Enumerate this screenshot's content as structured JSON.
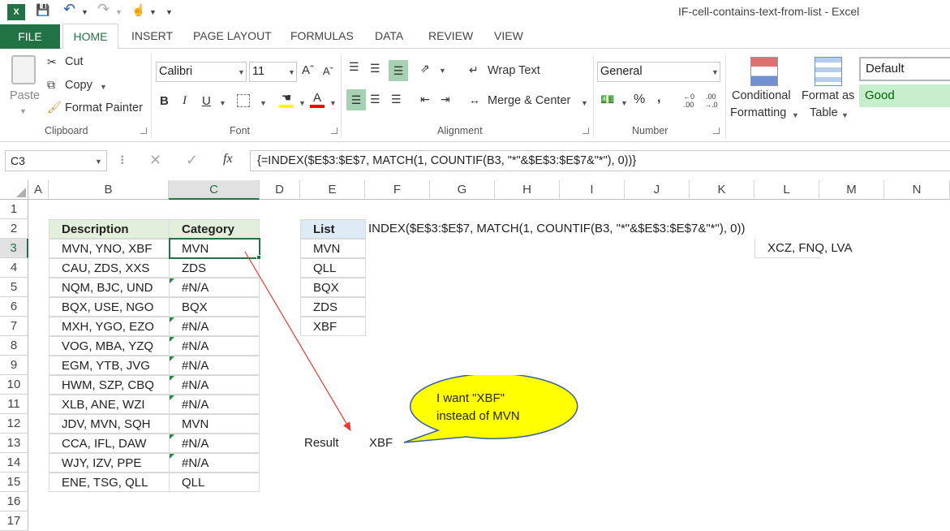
{
  "window": {
    "title": "IF-cell-contains-text-from-list - Excel"
  },
  "tabs": [
    "FILE",
    "HOME",
    "INSERT",
    "PAGE LAYOUT",
    "FORMULAS",
    "DATA",
    "REVIEW",
    "VIEW"
  ],
  "clipboard": {
    "paste": "Paste",
    "cut": "Cut",
    "copy": "Copy",
    "format_painter": "Format Painter",
    "label": "Clipboard"
  },
  "font": {
    "name": "Calibri",
    "size": "11",
    "label": "Font"
  },
  "alignment": {
    "wrap": "Wrap Text",
    "merge": "Merge & Center",
    "label": "Alignment"
  },
  "number": {
    "format": "General",
    "label": "Number"
  },
  "styles": {
    "cond1": "Conditional",
    "cond2": "Formatting",
    "fmt1": "Format as",
    "fmt2": "Table",
    "default": "Default",
    "good": "Good"
  },
  "formula_bar": {
    "name_box": "C3",
    "formula": "{=INDEX($E$3:$E$7, MATCH(1, COUNTIF(B3, \"*\"&$E$3:$E$7&\"*\"), 0))}"
  },
  "columns": [
    "A",
    "B",
    "C",
    "D",
    "E",
    "F",
    "G",
    "H",
    "I",
    "J",
    "K",
    "L",
    "M",
    "N"
  ],
  "rows": [
    "1",
    "2",
    "3",
    "4",
    "5",
    "6",
    "7",
    "8",
    "9",
    "10",
    "11",
    "12",
    "13",
    "14",
    "15",
    "16",
    "17"
  ],
  "table": {
    "headers": [
      "Description",
      "Category"
    ],
    "rows": [
      [
        "MVN, YNO, XBF",
        "MVN"
      ],
      [
        "CAU, ZDS, XXS",
        "ZDS"
      ],
      [
        "NQM, BJC, UND",
        "#N/A"
      ],
      [
        "BQX, USE, NGO",
        "BQX"
      ],
      [
        "MXH, YGO, EZO",
        "#N/A"
      ],
      [
        "VOG, MBA, YZQ",
        "#N/A"
      ],
      [
        "EGM, YTB, JVG",
        "#N/A"
      ],
      [
        "HWM, SZP, CBQ",
        "#N/A"
      ],
      [
        "XLB, ANE, WZI",
        "#N/A"
      ],
      [
        "JDV, MVN, SQH",
        "MVN"
      ],
      [
        "CCA, IFL, DAW",
        "#N/A"
      ],
      [
        "WJY, IZV, PPE",
        "#N/A"
      ],
      [
        "ENE, TSG, QLL",
        "QLL"
      ]
    ]
  },
  "list": {
    "header": "List",
    "items": [
      "MVN",
      "QLL",
      "BQX",
      "ZDS",
      "XBF"
    ]
  },
  "formula_text": "INDEX($E$3:$E$7, MATCH(1, COUNTIF(B3, \"*\"&$E$3:$E$7&\"*\"), 0))",
  "l3_value": "XCZ, FNQ, LVA",
  "result": {
    "label": "Result",
    "value": "XBF"
  },
  "callout": {
    "line1": "I want \"XBF\"",
    "line2": "instead of MVN"
  }
}
